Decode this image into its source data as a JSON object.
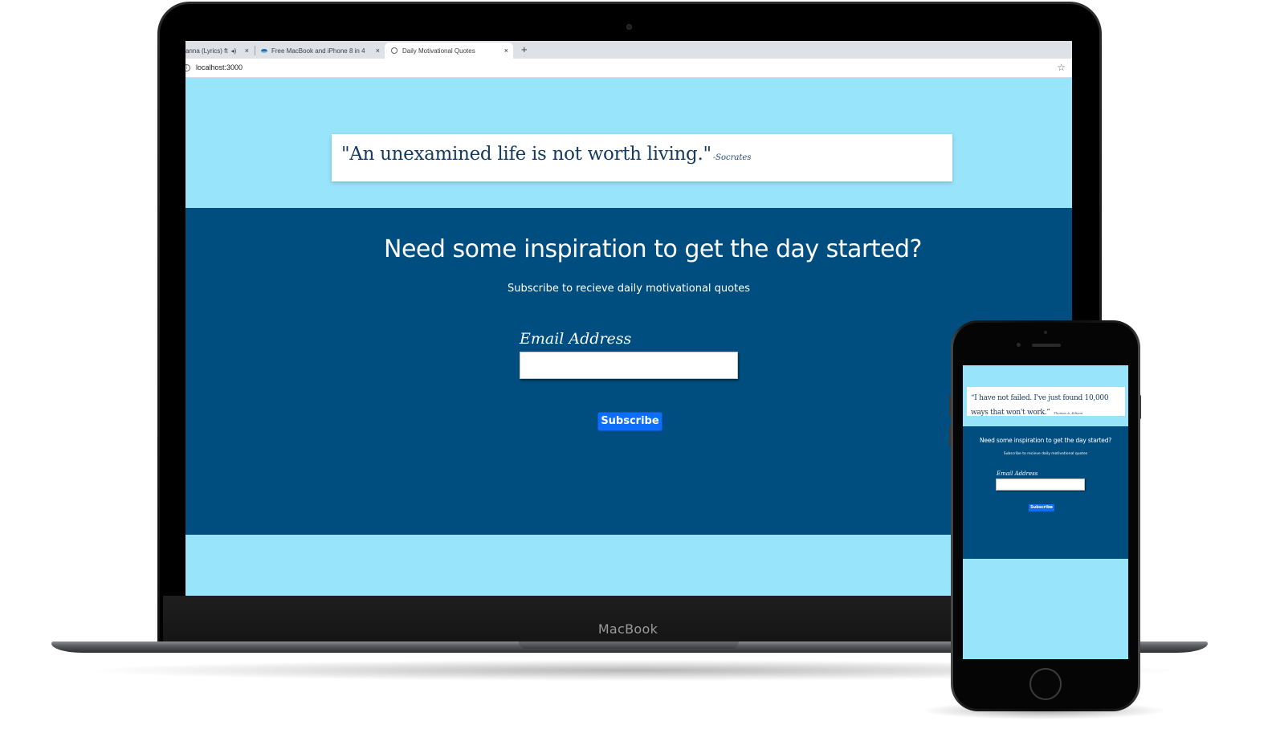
{
  "colors": {
    "sky_background": "#98e4fb",
    "hero_background": "#004e7f",
    "quote_text": "#163a5f",
    "button_blue": "#0d6efd"
  },
  "device": {
    "laptop_brand": "MacBook"
  },
  "browser": {
    "tabs": [
      {
        "title": "anna (Lyrics) ft",
        "icon": "speaker-icon"
      },
      {
        "title": "Free MacBook and iPhone 8 in 4",
        "icon": "site-favicon"
      },
      {
        "title": "Daily Motivational Quotes",
        "icon": "globe-icon",
        "active": true
      }
    ],
    "new_tab": "+",
    "close": "×",
    "address": "localhost:3000",
    "info_icon": "i",
    "bookmark_icon": "☆"
  },
  "page": {
    "quote": {
      "text": "\"An unexamined life is not worth living.\"",
      "author": "-Socrates"
    },
    "hero": {
      "title": "Need some inspiration to get the day started?",
      "subtitle": "Subscribe to recieve daily motivational quotes"
    },
    "form": {
      "email_label": "Email Address",
      "email_value": "",
      "subscribe_label": "Subscribe"
    }
  },
  "mobile": {
    "quote": {
      "text": "“I have not failed. I've just found 10,000 ways that won't work.”",
      "author": "Thomas A. Edison"
    },
    "hero": {
      "title": "Need some inspiration to get the day started?",
      "subtitle": "Subscribe to recieve daily motivational quotes"
    },
    "form": {
      "email_label": "Email Address",
      "subscribe_label": "Subscribe"
    }
  }
}
